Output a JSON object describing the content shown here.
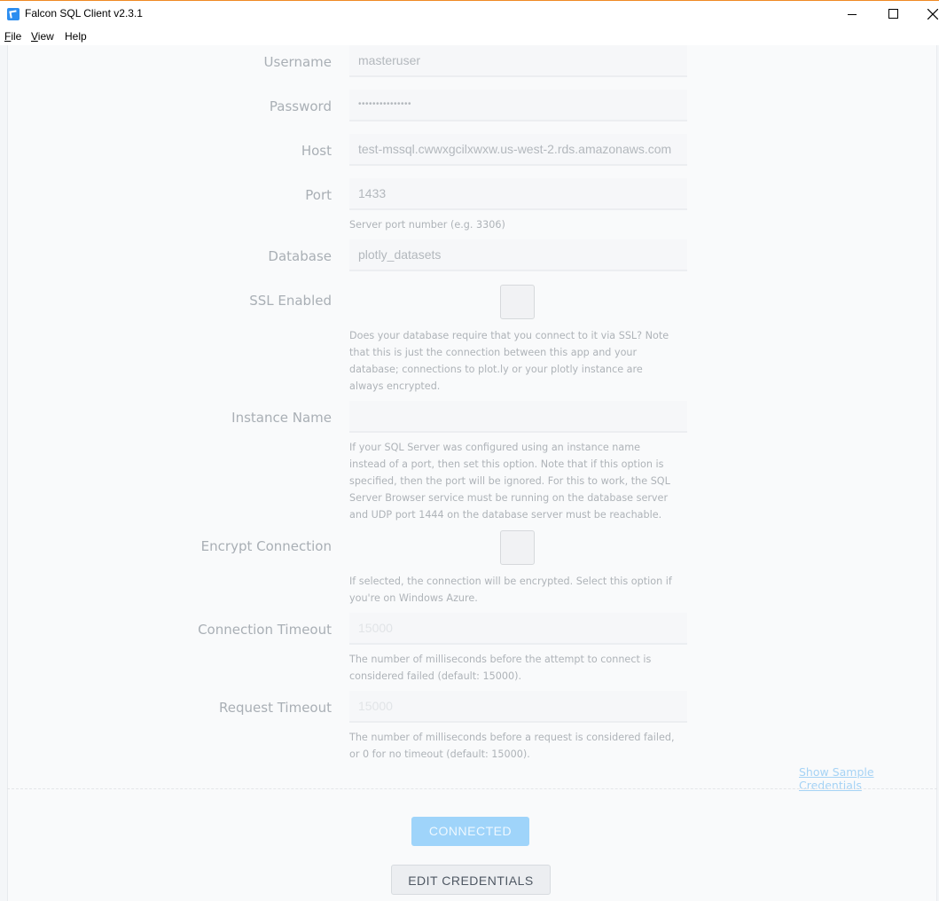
{
  "window": {
    "title": "Falcon SQL Client v2.3.1",
    "menu": [
      {
        "mnemonic": "F",
        "rest": "ile"
      },
      {
        "mnemonic": "V",
        "rest": "iew"
      },
      {
        "mnemonic": "",
        "rest": "Help"
      }
    ]
  },
  "form": {
    "username": {
      "label": "Username",
      "value": "masteruser"
    },
    "password": {
      "label": "Password",
      "value": "•••••••••••••••"
    },
    "host": {
      "label": "Host",
      "value": "test-mssql.cwwxgcilxwxw.us-west-2.rds.amazonaws.com"
    },
    "port": {
      "label": "Port",
      "value": "1433",
      "help": "Server port number (e.g. 3306)"
    },
    "database": {
      "label": "Database",
      "value": "plotly_datasets"
    },
    "ssl": {
      "label": "SSL Enabled",
      "checked": false,
      "help": "Does your database require that you connect to it via SSL? Note that this is just the connection between this app and your database; connections to plot.ly or your plotly instance are always encrypted."
    },
    "instance": {
      "label": "Instance Name",
      "value": "",
      "help": "If your SQL Server was configured using an instance name instead of a port, then set this option. Note that if this option is specified, then the port will be ignored. For this to work, the SQL Server Browser service must be running on the database server and UDP port 1444 on the database server must be reachable."
    },
    "encrypt": {
      "label": "Encrypt Connection",
      "checked": false,
      "help": "If selected, the connection will be encrypted. Select this option if you're on Windows Azure."
    },
    "connection_timeout": {
      "label": "Connection Timeout",
      "placeholder": "15000",
      "help": "The number of milliseconds before the attempt to connect is considered failed (default: 15000)."
    },
    "request_timeout": {
      "label": "Request Timeout",
      "placeholder": "15000",
      "help": "The number of milliseconds before a request is considered failed, or 0 for no timeout (default: 15000)."
    }
  },
  "actions": {
    "sample_credentials": "Show Sample Credentials",
    "connected": "CONNECTED",
    "edit": "EDIT CREDENTIALS"
  },
  "colors": {
    "accent": "#9fd4fa",
    "link": "#a6d3f5",
    "window_accent": "#f08a24"
  }
}
